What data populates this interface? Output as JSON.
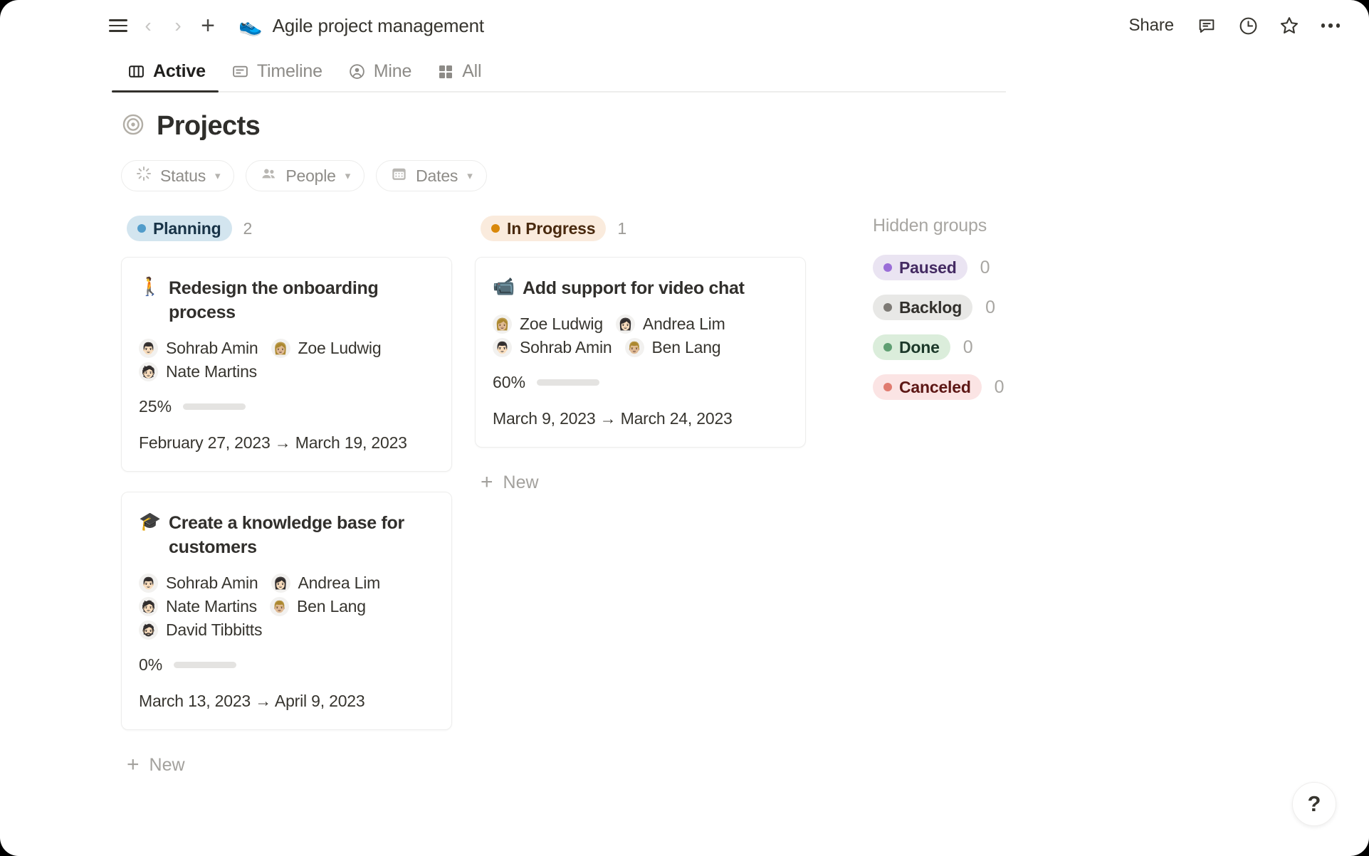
{
  "window": {
    "title": "Agile project management",
    "title_emoji": "👟",
    "share_label": "Share",
    "icons": [
      "menu-icon",
      "back-icon",
      "forward-icon",
      "plus-icon",
      "comment-icon",
      "history-icon",
      "favorite-icon",
      "more-options-icon"
    ]
  },
  "tabs": [
    {
      "label": "Active",
      "icon": "board-view-icon",
      "active": true
    },
    {
      "label": "Timeline",
      "icon": "timeline-view-icon",
      "active": false
    },
    {
      "label": "Mine",
      "icon": "person-circle-icon",
      "active": false
    },
    {
      "label": "All",
      "icon": "grid-view-icon",
      "active": false
    }
  ],
  "database": {
    "title": "Projects",
    "icon": "target-icon",
    "filters": [
      {
        "label": "Status",
        "icon": "spinner-icon"
      },
      {
        "label": "People",
        "icon": "people-icon"
      },
      {
        "label": "Dates",
        "icon": "calendar-icon"
      }
    ]
  },
  "board": {
    "columns": [
      {
        "status": "Planning",
        "count": "2",
        "pill_bg": "#d3e5ef",
        "pill_text": "#183347",
        "dot": "#529cca",
        "new_label": "New",
        "cards": [
          {
            "icon": "🚶",
            "icon_name": "walking-person-icon",
            "title": "Redesign the onboarding process",
            "people": [
              {
                "name": "Sohrab Amin",
                "avatar": "👨🏻"
              },
              {
                "name": "Zoe Ludwig",
                "avatar": "👩🏼"
              },
              {
                "name": "Nate Martins",
                "avatar": "🧑🏻"
              }
            ],
            "progress_label": "25%",
            "progress_value": 25,
            "dates": "February 27, 2023 → March 19, 2023"
          },
          {
            "icon": "🎓",
            "icon_name": "graduation-cap-icon",
            "title": "Create a knowledge base for customers",
            "people": [
              {
                "name": "Sohrab Amin",
                "avatar": "👨🏻"
              },
              {
                "name": "Andrea Lim",
                "avatar": "👩🏻"
              },
              {
                "name": "Nate Martins",
                "avatar": "🧑🏻"
              },
              {
                "name": "Ben Lang",
                "avatar": "👨🏼"
              },
              {
                "name": "David Tibbitts",
                "avatar": "🧔🏻"
              }
            ],
            "progress_label": "0%",
            "progress_value": 0,
            "dates": "March 13, 2023 → April 9, 2023"
          }
        ]
      },
      {
        "status": "In Progress",
        "count": "1",
        "pill_bg": "#faebdd",
        "pill_text": "#49290e",
        "dot": "#d9880a",
        "new_label": "New",
        "cards": [
          {
            "icon": "📹",
            "icon_name": "video-camera-icon",
            "title": "Add support for video chat",
            "people": [
              {
                "name": "Zoe Ludwig",
                "avatar": "👩🏼"
              },
              {
                "name": "Andrea Lim",
                "avatar": "👩🏻"
              },
              {
                "name": "Sohrab Amin",
                "avatar": "👨🏻"
              },
              {
                "name": "Ben Lang",
                "avatar": "👨🏼"
              }
            ],
            "progress_label": "60%",
            "progress_value": 60,
            "dates": "March 9, 2023 → March 24, 2023"
          }
        ]
      }
    ]
  },
  "hidden_groups": {
    "title": "Hidden groups",
    "items": [
      {
        "label": "Paused",
        "count": "0",
        "pill_bg": "#eae4f2",
        "pill_text": "#442a62",
        "dot": "#9a6dd7"
      },
      {
        "label": "Backlog",
        "count": "0",
        "pill_bg": "#e8e8e6",
        "pill_text": "#32302c",
        "dot": "#7d7a75"
      },
      {
        "label": "Done",
        "count": "0",
        "pill_bg": "#dbeddb",
        "pill_text": "#1c3829",
        "dot": "#5f9e72"
      },
      {
        "label": "Canceled",
        "count": "0",
        "pill_bg": "#fbe4e4",
        "pill_text": "#5d1715",
        "dot": "#e07b6f"
      }
    ]
  },
  "help": {
    "label": "?"
  }
}
